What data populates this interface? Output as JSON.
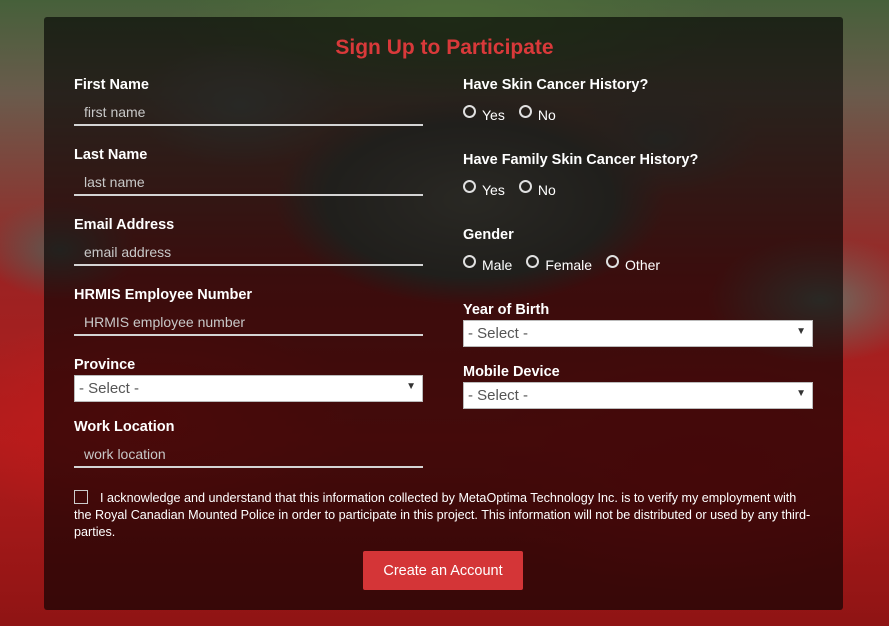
{
  "form": {
    "title": "Sign Up to Participate",
    "first_name": {
      "label": "First Name",
      "placeholder": "first name",
      "value": ""
    },
    "last_name": {
      "label": "Last Name",
      "placeholder": "last name",
      "value": ""
    },
    "email": {
      "label": "Email Address",
      "placeholder": "email address",
      "value": ""
    },
    "hrmis": {
      "label": "HRMIS Employee Number",
      "placeholder": "HRMIS employee number",
      "value": ""
    },
    "province": {
      "label": "Province",
      "selected": "- Select -"
    },
    "work_location": {
      "label": "Work Location",
      "placeholder": "work location",
      "value": ""
    },
    "skin_cancer_history": {
      "label": "Have Skin Cancer History?",
      "options": [
        "Yes",
        "No"
      ]
    },
    "family_skin_cancer_history": {
      "label": "Have Family Skin Cancer History?",
      "options": [
        "Yes",
        "No"
      ]
    },
    "gender": {
      "label": "Gender",
      "options": [
        "Male",
        "Female",
        "Other"
      ]
    },
    "year_of_birth": {
      "label": "Year of Birth",
      "selected": "- Select -"
    },
    "mobile_device": {
      "label": "Mobile Device",
      "selected": "- Select -"
    },
    "acknowledgement": "I acknowledge and understand that this information collected by MetaOptima Technology Inc. is to verify my employment with the Royal Canadian Mounted Police in order to participate in this project. This information will not be distributed or used by any third-parties.",
    "submit_label": "Create an Account"
  },
  "colors": {
    "accent": "#d43537",
    "title": "#d9393a",
    "panel": "rgba(0,0,0,0.62)"
  },
  "icons": {
    "select_arrow": "triangle-down-icon"
  }
}
